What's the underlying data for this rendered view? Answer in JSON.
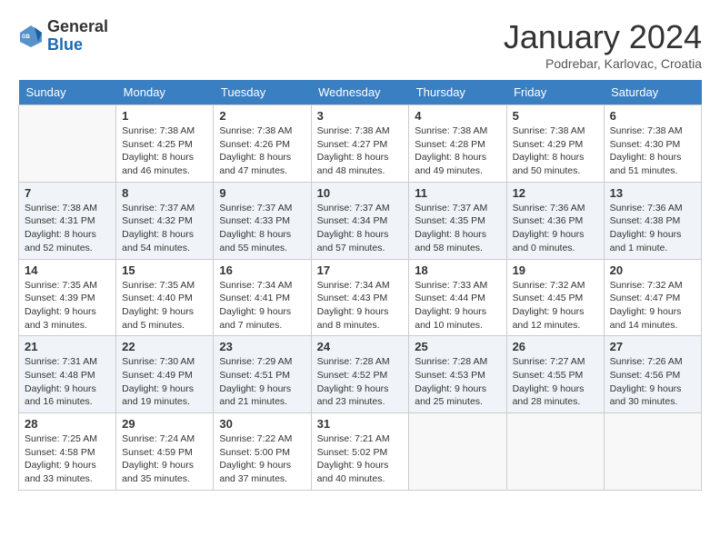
{
  "header": {
    "logo_general": "General",
    "logo_blue": "Blue",
    "month_title": "January 2024",
    "location": "Podrebar, Karlovac, Croatia"
  },
  "weekdays": [
    "Sunday",
    "Monday",
    "Tuesday",
    "Wednesday",
    "Thursday",
    "Friday",
    "Saturday"
  ],
  "weeks": [
    [
      {
        "day": "",
        "sunrise": "",
        "sunset": "",
        "daylight": ""
      },
      {
        "day": "1",
        "sunrise": "Sunrise: 7:38 AM",
        "sunset": "Sunset: 4:25 PM",
        "daylight": "Daylight: 8 hours and 46 minutes."
      },
      {
        "day": "2",
        "sunrise": "Sunrise: 7:38 AM",
        "sunset": "Sunset: 4:26 PM",
        "daylight": "Daylight: 8 hours and 47 minutes."
      },
      {
        "day": "3",
        "sunrise": "Sunrise: 7:38 AM",
        "sunset": "Sunset: 4:27 PM",
        "daylight": "Daylight: 8 hours and 48 minutes."
      },
      {
        "day": "4",
        "sunrise": "Sunrise: 7:38 AM",
        "sunset": "Sunset: 4:28 PM",
        "daylight": "Daylight: 8 hours and 49 minutes."
      },
      {
        "day": "5",
        "sunrise": "Sunrise: 7:38 AM",
        "sunset": "Sunset: 4:29 PM",
        "daylight": "Daylight: 8 hours and 50 minutes."
      },
      {
        "day": "6",
        "sunrise": "Sunrise: 7:38 AM",
        "sunset": "Sunset: 4:30 PM",
        "daylight": "Daylight: 8 hours and 51 minutes."
      }
    ],
    [
      {
        "day": "7",
        "sunrise": "Sunrise: 7:38 AM",
        "sunset": "Sunset: 4:31 PM",
        "daylight": "Daylight: 8 hours and 52 minutes."
      },
      {
        "day": "8",
        "sunrise": "Sunrise: 7:37 AM",
        "sunset": "Sunset: 4:32 PM",
        "daylight": "Daylight: 8 hours and 54 minutes."
      },
      {
        "day": "9",
        "sunrise": "Sunrise: 7:37 AM",
        "sunset": "Sunset: 4:33 PM",
        "daylight": "Daylight: 8 hours and 55 minutes."
      },
      {
        "day": "10",
        "sunrise": "Sunrise: 7:37 AM",
        "sunset": "Sunset: 4:34 PM",
        "daylight": "Daylight: 8 hours and 57 minutes."
      },
      {
        "day": "11",
        "sunrise": "Sunrise: 7:37 AM",
        "sunset": "Sunset: 4:35 PM",
        "daylight": "Daylight: 8 hours and 58 minutes."
      },
      {
        "day": "12",
        "sunrise": "Sunrise: 7:36 AM",
        "sunset": "Sunset: 4:36 PM",
        "daylight": "Daylight: 9 hours and 0 minutes."
      },
      {
        "day": "13",
        "sunrise": "Sunrise: 7:36 AM",
        "sunset": "Sunset: 4:38 PM",
        "daylight": "Daylight: 9 hours and 1 minute."
      }
    ],
    [
      {
        "day": "14",
        "sunrise": "Sunrise: 7:35 AM",
        "sunset": "Sunset: 4:39 PM",
        "daylight": "Daylight: 9 hours and 3 minutes."
      },
      {
        "day": "15",
        "sunrise": "Sunrise: 7:35 AM",
        "sunset": "Sunset: 4:40 PM",
        "daylight": "Daylight: 9 hours and 5 minutes."
      },
      {
        "day": "16",
        "sunrise": "Sunrise: 7:34 AM",
        "sunset": "Sunset: 4:41 PM",
        "daylight": "Daylight: 9 hours and 7 minutes."
      },
      {
        "day": "17",
        "sunrise": "Sunrise: 7:34 AM",
        "sunset": "Sunset: 4:43 PM",
        "daylight": "Daylight: 9 hours and 8 minutes."
      },
      {
        "day": "18",
        "sunrise": "Sunrise: 7:33 AM",
        "sunset": "Sunset: 4:44 PM",
        "daylight": "Daylight: 9 hours and 10 minutes."
      },
      {
        "day": "19",
        "sunrise": "Sunrise: 7:32 AM",
        "sunset": "Sunset: 4:45 PM",
        "daylight": "Daylight: 9 hours and 12 minutes."
      },
      {
        "day": "20",
        "sunrise": "Sunrise: 7:32 AM",
        "sunset": "Sunset: 4:47 PM",
        "daylight": "Daylight: 9 hours and 14 minutes."
      }
    ],
    [
      {
        "day": "21",
        "sunrise": "Sunrise: 7:31 AM",
        "sunset": "Sunset: 4:48 PM",
        "daylight": "Daylight: 9 hours and 16 minutes."
      },
      {
        "day": "22",
        "sunrise": "Sunrise: 7:30 AM",
        "sunset": "Sunset: 4:49 PM",
        "daylight": "Daylight: 9 hours and 19 minutes."
      },
      {
        "day": "23",
        "sunrise": "Sunrise: 7:29 AM",
        "sunset": "Sunset: 4:51 PM",
        "daylight": "Daylight: 9 hours and 21 minutes."
      },
      {
        "day": "24",
        "sunrise": "Sunrise: 7:28 AM",
        "sunset": "Sunset: 4:52 PM",
        "daylight": "Daylight: 9 hours and 23 minutes."
      },
      {
        "day": "25",
        "sunrise": "Sunrise: 7:28 AM",
        "sunset": "Sunset: 4:53 PM",
        "daylight": "Daylight: 9 hours and 25 minutes."
      },
      {
        "day": "26",
        "sunrise": "Sunrise: 7:27 AM",
        "sunset": "Sunset: 4:55 PM",
        "daylight": "Daylight: 9 hours and 28 minutes."
      },
      {
        "day": "27",
        "sunrise": "Sunrise: 7:26 AM",
        "sunset": "Sunset: 4:56 PM",
        "daylight": "Daylight: 9 hours and 30 minutes."
      }
    ],
    [
      {
        "day": "28",
        "sunrise": "Sunrise: 7:25 AM",
        "sunset": "Sunset: 4:58 PM",
        "daylight": "Daylight: 9 hours and 33 minutes."
      },
      {
        "day": "29",
        "sunrise": "Sunrise: 7:24 AM",
        "sunset": "Sunset: 4:59 PM",
        "daylight": "Daylight: 9 hours and 35 minutes."
      },
      {
        "day": "30",
        "sunrise": "Sunrise: 7:22 AM",
        "sunset": "Sunset: 5:00 PM",
        "daylight": "Daylight: 9 hours and 37 minutes."
      },
      {
        "day": "31",
        "sunrise": "Sunrise: 7:21 AM",
        "sunset": "Sunset: 5:02 PM",
        "daylight": "Daylight: 9 hours and 40 minutes."
      },
      {
        "day": "",
        "sunrise": "",
        "sunset": "",
        "daylight": ""
      },
      {
        "day": "",
        "sunrise": "",
        "sunset": "",
        "daylight": ""
      },
      {
        "day": "",
        "sunrise": "",
        "sunset": "",
        "daylight": ""
      }
    ]
  ]
}
